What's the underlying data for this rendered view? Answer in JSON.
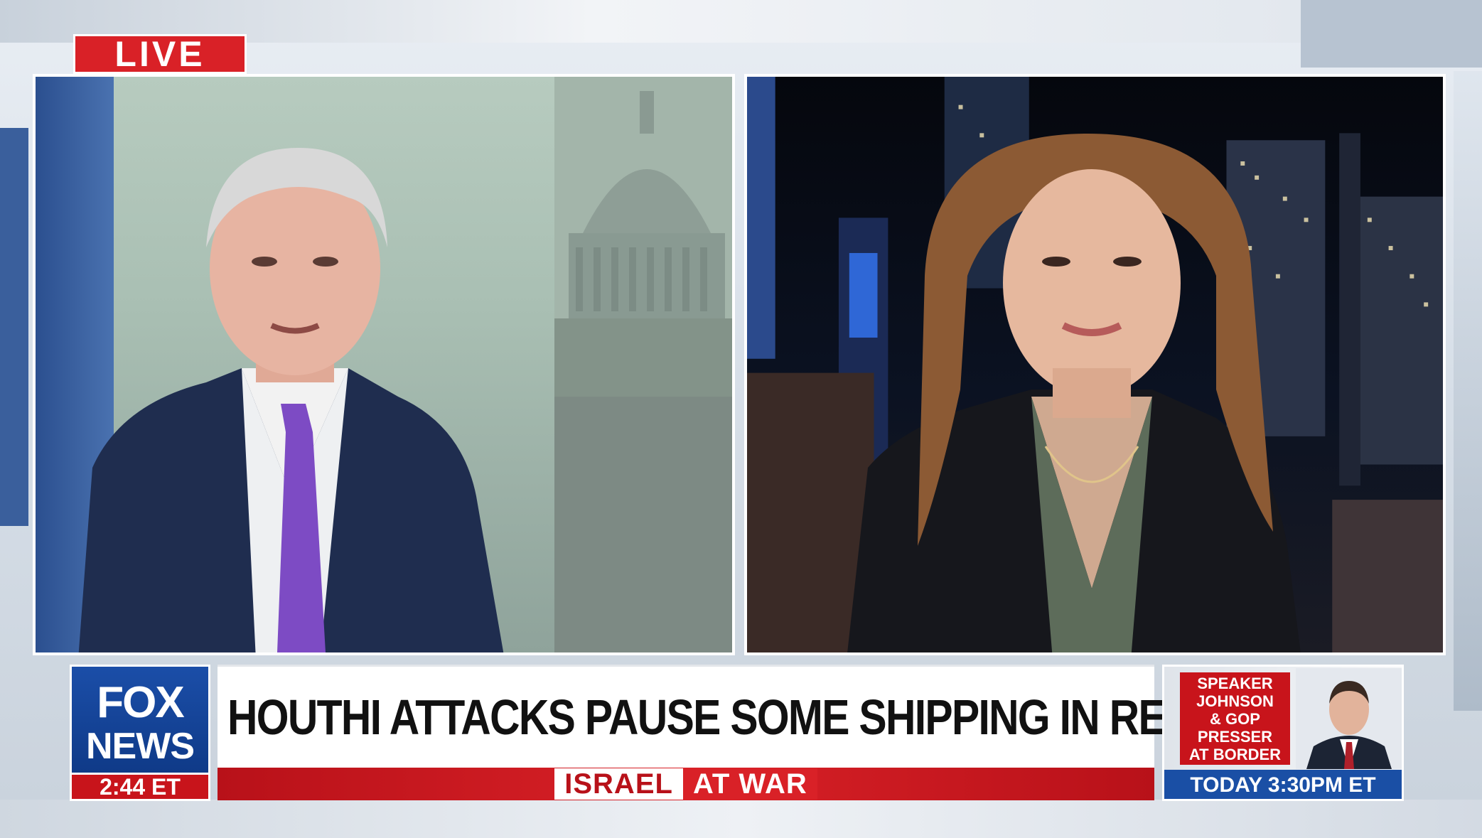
{
  "live_label": "LIVE",
  "network": {
    "logo_top": "FOX",
    "logo_bottom": "NEWS"
  },
  "clock": "2:44 ET",
  "headline": "HOUTHI ATTACKS PAUSE SOME SHIPPING IN RED SEA",
  "ticker": {
    "part1": "ISRAEL",
    "part2": "AT WAR"
  },
  "promo": {
    "title": "SPEAKER\nJOHNSON\n& GOP\nPRESSER\nAT BORDER",
    "time": "TODAY 3:30PM ET"
  },
  "colors": {
    "fox_red": "#d92127",
    "fox_blue": "#1a4fa5",
    "headline_text": "#111111"
  }
}
